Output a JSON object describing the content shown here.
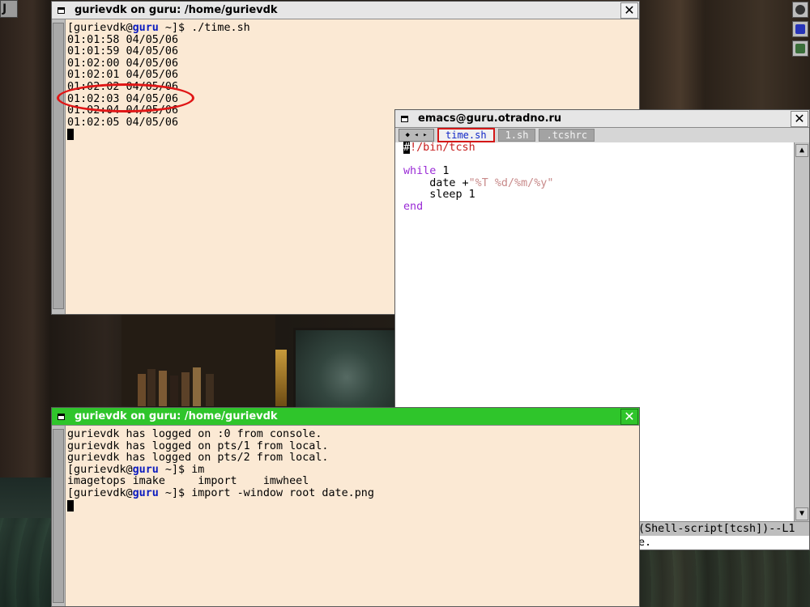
{
  "desktop": {
    "corner_glyph": "J"
  },
  "term1": {
    "title": "gurievdk on guru: /home/gurievdk",
    "close_label": "✕",
    "prompt_open": "[gurievdk@",
    "host": "guru",
    "prompt_close": " ~]$ ",
    "command": "./time.sh",
    "lines": [
      "01:01:58 04/05/06",
      "01:01:59 04/05/06",
      "01:02:00 04/05/06",
      "01:02:01 04/05/06",
      "01:02:02 04/05/06",
      "01:02:03 04/05/06",
      "01:02:04 04/05/06",
      "01:02:05 04/05/06"
    ],
    "highlighted_line": "01:02:03 04/05/06"
  },
  "emacs": {
    "title": "emacs@guru.otradno.ru",
    "close_label": "✕",
    "nav_label": "◆ ◂ ▸",
    "tabs": [
      {
        "label": "time.sh",
        "current": true
      },
      {
        "label": "1.sh",
        "current": false
      },
      {
        "label": ".tcshrc",
        "current": false
      }
    ],
    "code": {
      "shebang_hash": "#",
      "shebang_rest": "!/bin/tcsh",
      "kw_while": "while",
      "while_arg": " 1",
      "date_cmd": "    date +",
      "date_fmt": "\"%T %d/%m/%y\"",
      "sleep_cmd": "    sleep 1",
      "kw_end": "end"
    },
    "modeline": "(Shell-script[tcsh])--L1",
    "minibuffer": "e."
  },
  "term2": {
    "title": "gurievdk on guru: /home/gurievdk",
    "close_label": "✕",
    "lines": [
      "gurievdk has logged on :0 from console.",
      "gurievdk has logged on pts/1 from local.",
      "gurievdk has logged on pts/2 from local."
    ],
    "prompt_open": "[gurievdk@",
    "host": "guru",
    "prompt_close": " ~]$ ",
    "cmd1": "im",
    "completions": "imagetops imake     import    imwheel",
    "cmd2": "import -window root date.png"
  },
  "colors": {
    "terminal_bg": "#fbe9d4",
    "active_titlebar": "#2fc52b",
    "host_color": "#0b1bbf",
    "annotation": "#e01616"
  }
}
